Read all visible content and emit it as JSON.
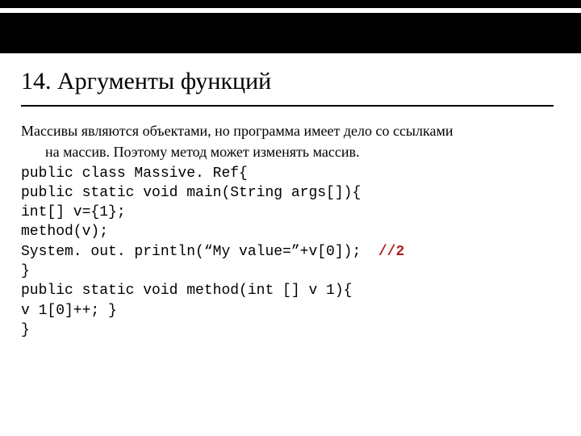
{
  "slide": {
    "title": "14. Аргументы функций",
    "intro_line1": "Массивы являются объектами, но программа имеет дело со ссылками",
    "intro_line2": "на массив. Поэтому метод может изменять массив.",
    "code": {
      "l1": "public class Massive. Ref{",
      "l2": "public static void main(String args[]){",
      "l3": "int[] v={1};",
      "l4": "method(v);",
      "l5a": "System. out. println(“My value=”+v[0]);  ",
      "l5b": "//2",
      "l6": "}",
      "l7": "public static void method(int [] v 1){",
      "l8": "v 1[0]++; }",
      "l9": "}"
    }
  }
}
